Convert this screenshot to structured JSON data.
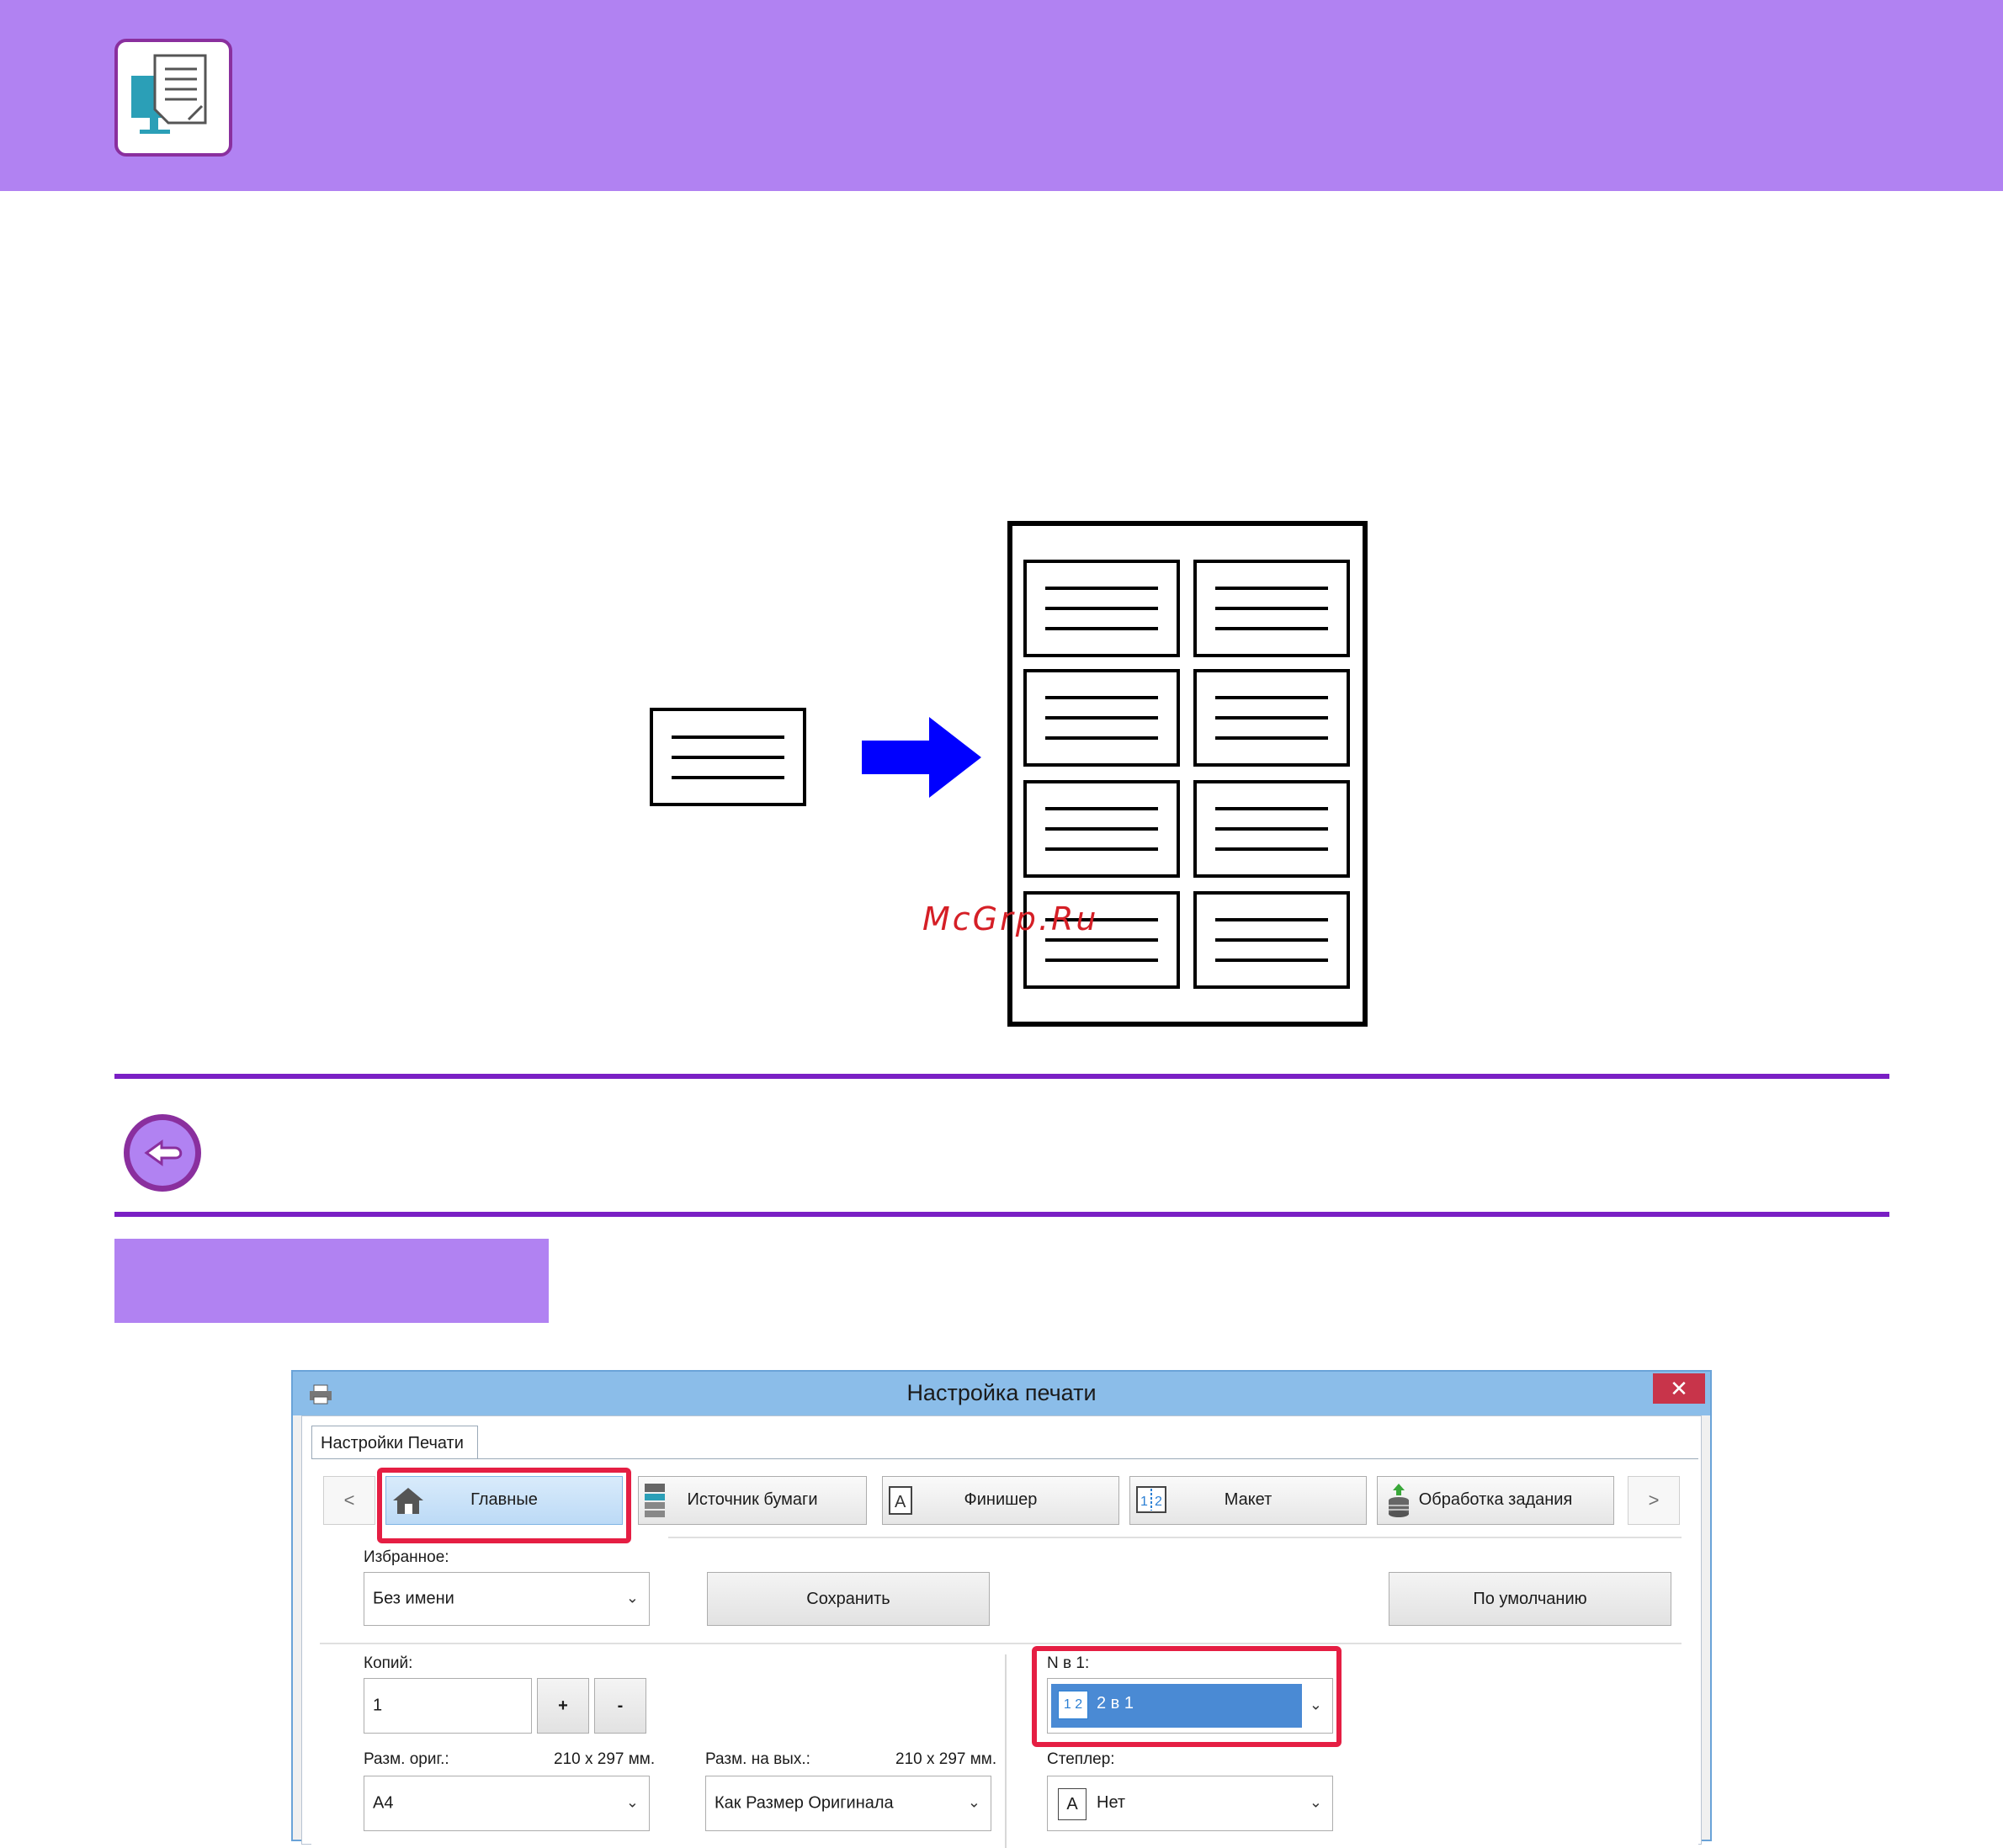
{
  "watermark": "McGrp.Ru",
  "dialog": {
    "title": "Настройка печати",
    "close_label": "✕",
    "tab_label": "Настройки Печати",
    "nav": {
      "prev": "<",
      "next": ">",
      "items": [
        {
          "label": "Главные",
          "icon": "home-icon"
        },
        {
          "label": "Источник бумаги",
          "icon": "printer-tray-icon"
        },
        {
          "label": "Финишер",
          "icon": "finisher-icon"
        },
        {
          "label": "Макет",
          "icon": "layout-icon"
        },
        {
          "label": "Обработка задания",
          "icon": "job-handling-icon"
        }
      ]
    },
    "favorites_label": "Избранное:",
    "favorites_value": "Без имени",
    "save_label": "Сохранить",
    "default_label": "По умолчанию",
    "copies_label": "Копий:",
    "copies_value": "1",
    "plus_label": "+",
    "minus_label": "-",
    "orig_size_label": "Разм. ориг.:",
    "orig_size_dims": "210 x 297 мм.",
    "orig_size_value": "A4",
    "out_size_label": "Разм. на вых.:",
    "out_size_dims": "210 x 297 мм.",
    "out_size_value": "Как Размер Оригинала",
    "nup_label": "N в 1:",
    "nup_icon_text": "1 2",
    "nup_value": "2 в 1",
    "stapler_label": "Степлер:",
    "stapler_icon_text": "A",
    "stapler_value": "Нет"
  },
  "colors": {
    "header": "#b182f2",
    "rule": "#7a1fc4",
    "highlight": "#e51e43",
    "arrow": "#0000ff",
    "selected": "#4a8ad4"
  }
}
